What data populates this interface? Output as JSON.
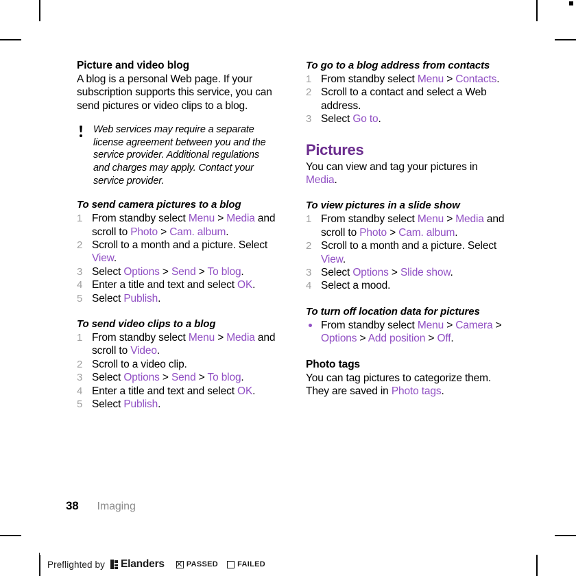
{
  "colors": {
    "ui_term": "#9150C4",
    "section_heading": "#6B2D8E",
    "step_number": "#A0A0A0",
    "folio_label": "#8C8C8C"
  },
  "left_column": {
    "topic_heading": "Picture and video blog",
    "intro_paragraph": "A blog is a personal Web page. If your subscription supports this service, you can send pictures or video clips to a blog.",
    "note": {
      "icon": "exclamation-icon",
      "text": "Web services may require a separate license agreement between you and the service provider. Additional regulations and charges may apply. Contact your service provider."
    },
    "procedure_camera": {
      "heading": "To send camera pictures to a blog",
      "steps": [
        {
          "num": "1",
          "parts": [
            {
              "t": "From standby select ",
              "ui": false
            },
            {
              "t": "Menu",
              "ui": true
            },
            {
              "t": " > ",
              "ui": false
            },
            {
              "t": "Media",
              "ui": true
            },
            {
              "t": " and scroll to ",
              "ui": false
            },
            {
              "t": "Photo",
              "ui": true
            },
            {
              "t": " > ",
              "ui": false
            },
            {
              "t": "Cam. album",
              "ui": true
            },
            {
              "t": ".",
              "ui": false
            }
          ]
        },
        {
          "num": "2",
          "parts": [
            {
              "t": "Scroll to a month and a picture. Select ",
              "ui": false
            },
            {
              "t": "View",
              "ui": true
            },
            {
              "t": ".",
              "ui": false
            }
          ]
        },
        {
          "num": "3",
          "parts": [
            {
              "t": "Select ",
              "ui": false
            },
            {
              "t": "Options",
              "ui": true
            },
            {
              "t": " > ",
              "ui": false
            },
            {
              "t": "Send",
              "ui": true
            },
            {
              "t": " > ",
              "ui": false
            },
            {
              "t": "To blog",
              "ui": true
            },
            {
              "t": ".",
              "ui": false
            }
          ]
        },
        {
          "num": "4",
          "parts": [
            {
              "t": "Enter a title and text and select ",
              "ui": false
            },
            {
              "t": "OK",
              "ui": true
            },
            {
              "t": ".",
              "ui": false
            }
          ]
        },
        {
          "num": "5",
          "parts": [
            {
              "t": "Select ",
              "ui": false
            },
            {
              "t": "Publish",
              "ui": true
            },
            {
              "t": ".",
              "ui": false
            }
          ]
        }
      ]
    },
    "procedure_video": {
      "heading": "To send video clips to a blog",
      "steps": [
        {
          "num": "1",
          "parts": [
            {
              "t": "From standby select ",
              "ui": false
            },
            {
              "t": "Menu",
              "ui": true
            },
            {
              "t": " > ",
              "ui": false
            },
            {
              "t": "Media",
              "ui": true
            },
            {
              "t": " and scroll to ",
              "ui": false
            },
            {
              "t": "Video",
              "ui": true
            },
            {
              "t": ".",
              "ui": false
            }
          ]
        },
        {
          "num": "2",
          "parts": [
            {
              "t": "Scroll to a video clip.",
              "ui": false
            }
          ]
        },
        {
          "num": "3",
          "parts": [
            {
              "t": "Select ",
              "ui": false
            },
            {
              "t": "Options",
              "ui": true
            },
            {
              "t": " > ",
              "ui": false
            },
            {
              "t": "Send",
              "ui": true
            },
            {
              "t": " > ",
              "ui": false
            },
            {
              "t": "To blog",
              "ui": true
            },
            {
              "t": ".",
              "ui": false
            }
          ]
        },
        {
          "num": "4",
          "parts": [
            {
              "t": "Enter a title and text and select ",
              "ui": false
            },
            {
              "t": "OK",
              "ui": true
            },
            {
              "t": ".",
              "ui": false
            }
          ]
        },
        {
          "num": "5",
          "parts": [
            {
              "t": "Select ",
              "ui": false
            },
            {
              "t": "Publish",
              "ui": true
            },
            {
              "t": ".",
              "ui": false
            }
          ]
        }
      ]
    }
  },
  "right_column": {
    "procedure_blog_address": {
      "heading": "To go to a blog address from contacts",
      "steps": [
        {
          "num": "1",
          "parts": [
            {
              "t": "From standby select ",
              "ui": false
            },
            {
              "t": "Menu",
              "ui": true
            },
            {
              "t": " > ",
              "ui": false
            },
            {
              "t": "Contacts",
              "ui": true
            },
            {
              "t": ".",
              "ui": false
            }
          ]
        },
        {
          "num": "2",
          "parts": [
            {
              "t": "Scroll to a contact and select a Web address.",
              "ui": false
            }
          ]
        },
        {
          "num": "3",
          "parts": [
            {
              "t": "Select ",
              "ui": false
            },
            {
              "t": "Go to",
              "ui": true
            },
            {
              "t": ".",
              "ui": false
            }
          ]
        }
      ]
    },
    "section_heading": "Pictures",
    "section_paragraph": {
      "parts": [
        {
          "t": "You can view and tag your pictures in ",
          "ui": false
        },
        {
          "t": "Media",
          "ui": true
        },
        {
          "t": ".",
          "ui": false
        }
      ]
    },
    "procedure_slideshow": {
      "heading": "To view pictures in a slide show",
      "steps": [
        {
          "num": "1",
          "parts": [
            {
              "t": "From standby select ",
              "ui": false
            },
            {
              "t": "Menu",
              "ui": true
            },
            {
              "t": " > ",
              "ui": false
            },
            {
              "t": "Media",
              "ui": true
            },
            {
              "t": " and scroll to ",
              "ui": false
            },
            {
              "t": "Photo",
              "ui": true
            },
            {
              "t": " > ",
              "ui": false
            },
            {
              "t": "Cam. album",
              "ui": true
            },
            {
              "t": ".",
              "ui": false
            }
          ]
        },
        {
          "num": "2",
          "parts": [
            {
              "t": "Scroll to a month and a picture. Select ",
              "ui": false
            },
            {
              "t": "View",
              "ui": true
            },
            {
              "t": ".",
              "ui": false
            }
          ]
        },
        {
          "num": "3",
          "parts": [
            {
              "t": "Select ",
              "ui": false
            },
            {
              "t": "Options",
              "ui": true
            },
            {
              "t": " > ",
              "ui": false
            },
            {
              "t": "Slide show",
              "ui": true
            },
            {
              "t": ".",
              "ui": false
            }
          ]
        },
        {
          "num": "4",
          "parts": [
            {
              "t": "Select a mood.",
              "ui": false
            }
          ]
        }
      ]
    },
    "procedure_location": {
      "heading": "To turn off location data for pictures",
      "bullets": [
        {
          "parts": [
            {
              "t": "From standby select ",
              "ui": false
            },
            {
              "t": "Menu",
              "ui": true
            },
            {
              "t": " > ",
              "ui": false
            },
            {
              "t": "Camera",
              "ui": true
            },
            {
              "t": " > ",
              "ui": false
            },
            {
              "t": "Options",
              "ui": true
            },
            {
              "t": " > ",
              "ui": false
            },
            {
              "t": "Add position",
              "ui": true
            },
            {
              "t": " > ",
              "ui": false
            },
            {
              "t": "Off",
              "ui": true
            },
            {
              "t": ".",
              "ui": false
            }
          ]
        }
      ]
    },
    "topic_phototags": {
      "heading": "Photo tags",
      "paragraph": {
        "parts": [
          {
            "t": "You can tag pictures to categorize them. They are saved in ",
            "ui": false
          },
          {
            "t": "Photo tags",
            "ui": true
          },
          {
            "t": ".",
            "ui": false
          }
        ]
      }
    }
  },
  "footer": {
    "page_number": "38",
    "chapter_label": "Imaging"
  },
  "preflight_bar": {
    "prefix_text": "Preflighted by",
    "brand": "Elanders",
    "logo_icon": "elanders-logo-icon",
    "statuses": [
      {
        "label": "PASSED",
        "checked": true
      },
      {
        "label": "FAILED",
        "checked": false
      }
    ]
  }
}
